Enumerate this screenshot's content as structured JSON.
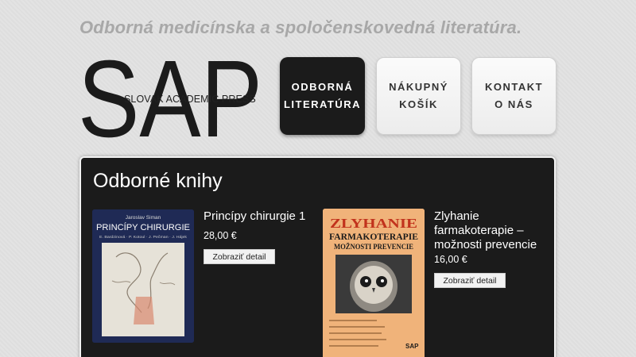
{
  "header": {
    "tagline": "Odborná medicínska a spoločenskovedná literatúra.",
    "logo_letters": "SAP",
    "logo_sub": "SLOVAK ACADEMIC PRESS"
  },
  "nav": [
    {
      "label": "ODBORNÁ\nLITERATÚRA",
      "active": true
    },
    {
      "label": "NÁKUPNÝ\nKOŠÍK",
      "active": false
    },
    {
      "label": "KONTAKT\nO NÁS",
      "active": false
    }
  ],
  "main": {
    "title": "Odborné knihy",
    "books": [
      {
        "title": "Princípy chirurgie 1",
        "price": "28,00 €",
        "button": "Zobraziť detail",
        "cover": {
          "author": "Jaroslav Siman",
          "title": "PRINCÍPY CHIRURGIE",
          "authors_line": "E. Bardzinová · P. Kotoul · J. Pečman · J. Hájek"
        }
      },
      {
        "title": "Zlyhanie farmakoterapie – možnosti prevencie",
        "price": "16,00 €",
        "button": "Zobraziť detail",
        "cover": {
          "title1": "ZLYHANIE",
          "title2": "FARMAKOTERAPIE",
          "title3": "MOŽNOSTI PREVENCIE",
          "publisher": "SAP"
        }
      }
    ]
  },
  "colors": {
    "panel_bg": "#1b1b1b",
    "nav_active": "#1b1b1b",
    "cover1_bg": "#1f2a55",
    "cover2_bg": "#f0b37a",
    "cover2_title": "#c1321c"
  }
}
